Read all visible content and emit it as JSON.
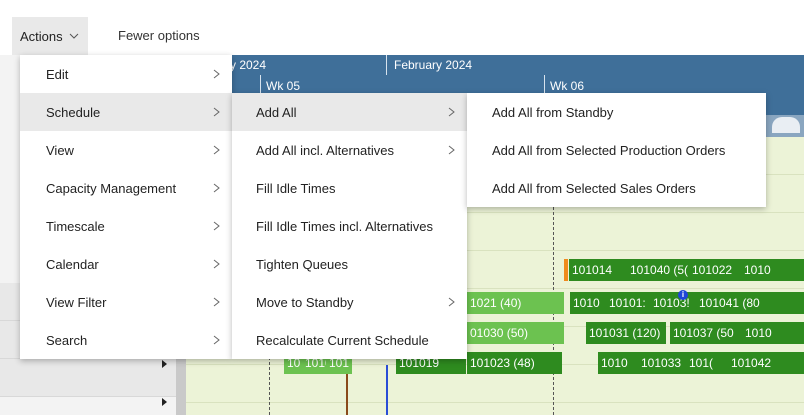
{
  "toolbar": {
    "actions_label": "Actions",
    "fewer_options_label": "Fewer options"
  },
  "timeline": {
    "month_prev": "y 2024",
    "month_next": "February 2024",
    "week1": "Wk 05",
    "week2": "Wk 06"
  },
  "menu_main": {
    "items": [
      {
        "label": "Edit"
      },
      {
        "label": "Schedule"
      },
      {
        "label": "View"
      },
      {
        "label": "Capacity Management"
      },
      {
        "label": "Timescale"
      },
      {
        "label": "Calendar"
      },
      {
        "label": "View Filter"
      },
      {
        "label": "Search"
      }
    ]
  },
  "menu_schedule": {
    "items": [
      {
        "label": "Add All"
      },
      {
        "label": "Add All incl. Alternatives"
      },
      {
        "label": "Fill Idle Times"
      },
      {
        "label": "Fill Idle Times incl. Alternatives"
      },
      {
        "label": "Tighten Queues"
      },
      {
        "label": "Move to Standby"
      },
      {
        "label": "Recalculate Current Schedule"
      }
    ]
  },
  "menu_add_all": {
    "items": [
      {
        "label": "Add All from Standby"
      },
      {
        "label": "Add All from Selected Production Orders"
      },
      {
        "label": "Add All from Selected Sales Orders"
      }
    ]
  },
  "gantt": {
    "row1": [
      "101014",
      "101040 (5(",
      "101022",
      "1010"
    ],
    "row2": [
      "1021 (40)",
      "1010",
      "10101:",
      "10103!",
      "101041 (80"
    ],
    "row3": [
      "01030 (50)",
      "101031 (120)",
      "101037 (50",
      "1010"
    ],
    "row4": [
      "10",
      "1010",
      "101",
      "101019",
      "101023 (48)",
      "1010",
      "101033",
      "101(",
      "101042"
    ]
  },
  "colors": {
    "header_blue": "#3f6f99",
    "bar_dark": "#2e8b1f",
    "bar_light": "#6cc250",
    "lane_bg": "#ecf3d7"
  }
}
